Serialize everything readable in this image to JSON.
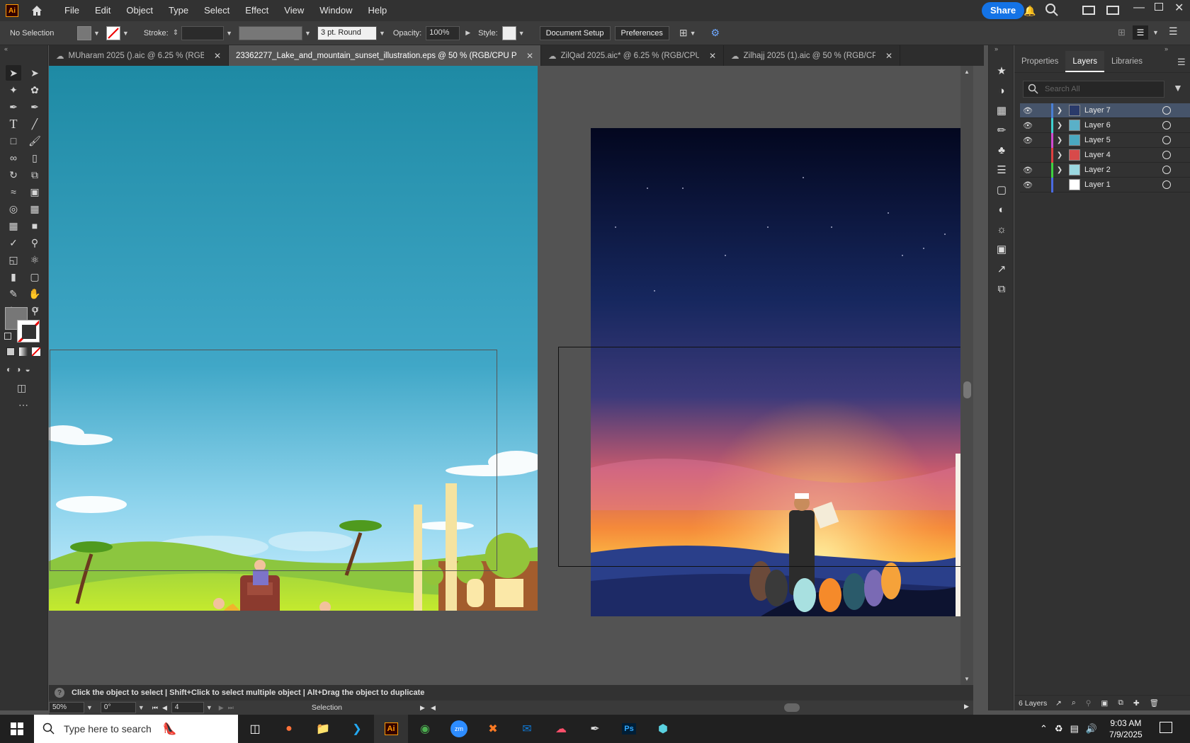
{
  "app": {
    "logo": "Ai"
  },
  "menubar": {
    "items": [
      "File",
      "Edit",
      "Object",
      "Type",
      "Select",
      "Effect",
      "View",
      "Window",
      "Help"
    ],
    "share_label": "Share"
  },
  "control": {
    "selection": "No Selection",
    "stroke_label": "Stroke:",
    "brush_label": "3 pt. Round",
    "opacity_label": "Opacity:",
    "opacity_value": "100%",
    "style_label": "Style:",
    "doc_setup_label": "Document Setup",
    "preferences_label": "Preferences"
  },
  "tabs": [
    {
      "label": "MUharam 2025 ().aic @ 6.25 % (RGB/CP...",
      "active": false
    },
    {
      "label": "23362277_Lake_and_mountain_sunset_illustration.eps @ 50 % (RGB/CPU Preview)",
      "active": true
    },
    {
      "label": "ZilQad 2025.aic* @ 6.25 % (RGB/CPU Pr...",
      "active": false
    },
    {
      "label": "Zilhajj 2025 (1).aic @ 50 % (RGB/CPU Pr...",
      "active": false
    }
  ],
  "panel": {
    "tabs": [
      "Properties",
      "Layers",
      "Libraries"
    ],
    "active_tab": "Layers",
    "search_placeholder": "Search All",
    "layers": [
      {
        "name": "Layer 7",
        "color": "#4a7fd4",
        "visible": true,
        "selected": true,
        "thumb": "#2a3a6a"
      },
      {
        "name": "Layer 6",
        "color": "#3fd0d0",
        "visible": true,
        "selected": false,
        "thumb": "#5ab0c8"
      },
      {
        "name": "Layer 5",
        "color": "#d04ad0",
        "visible": true,
        "selected": false,
        "thumb": "#4aa8c0"
      },
      {
        "name": "Layer 4",
        "color": "#e04040",
        "visible": false,
        "selected": false,
        "thumb": "#d84a4a"
      },
      {
        "name": "Layer 2",
        "color": "#3ed040",
        "visible": true,
        "selected": false,
        "thumb": "#9ad8e0"
      },
      {
        "name": "Layer 1",
        "color": "#4a6ae0",
        "visible": true,
        "selected": false,
        "thumb": "#ffffff"
      }
    ],
    "footer_count": "6 Layers"
  },
  "status": {
    "hint": "Click the object to select  |  Shift+Click to select multiple object  |  Alt+Drag the object to duplicate",
    "zoom": "50%",
    "rotation": "0°",
    "artboard": "4",
    "tool": "Selection"
  },
  "taskbar": {
    "search_placeholder": "Type here to search",
    "time": "9:03 AM",
    "date": "7/9/2025"
  }
}
